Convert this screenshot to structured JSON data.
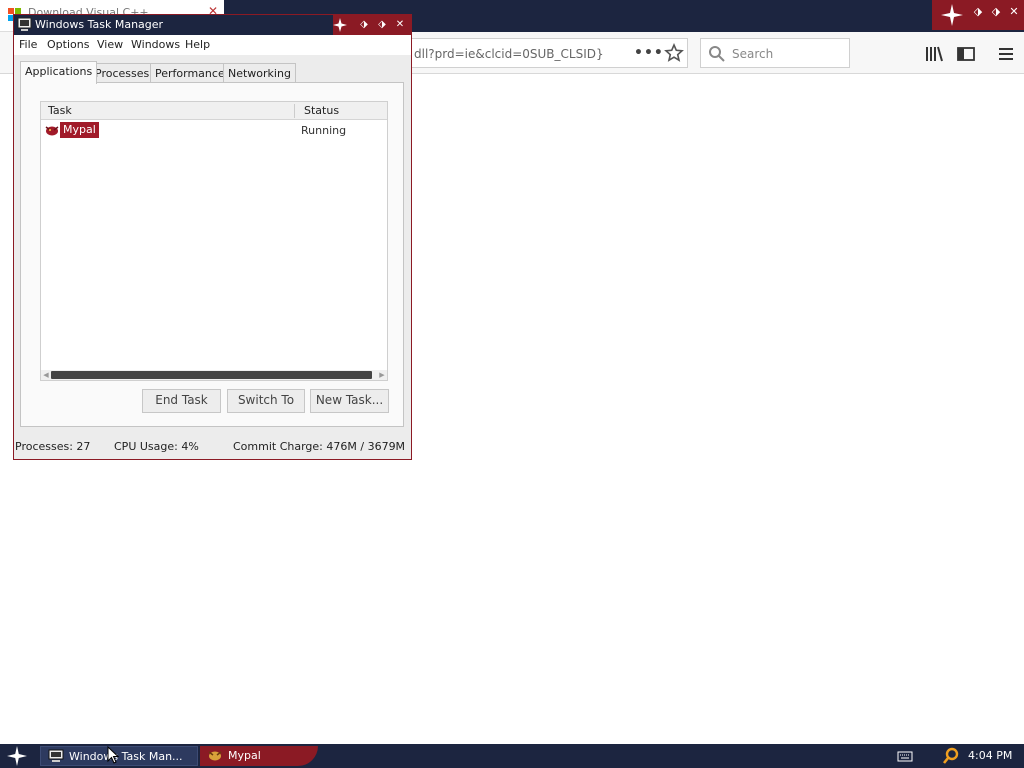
{
  "browser": {
    "tab_title": "Download Visual C++",
    "url_fragment": "dll?prd=ie&clcid=0SUB_CLSID}&",
    "url_overflow_dots": "•••",
    "search_placeholder": "Search",
    "colors": {
      "titlebar": "#1c2540",
      "accent": "#8b1a24"
    }
  },
  "task_manager": {
    "title": "Windows Task Manager",
    "menu": [
      "File",
      "Options",
      "View",
      "Windows",
      "Help"
    ],
    "tabs": [
      "Applications",
      "Processes",
      "Performance",
      "Networking"
    ],
    "active_tab": "Applications",
    "columns": {
      "task": "Task",
      "status": "Status"
    },
    "rows": [
      {
        "task": "Mypal",
        "status": "Running"
      }
    ],
    "buttons": {
      "end_task": "End Task",
      "switch_to": "Switch To",
      "new_task": "New Task..."
    },
    "status_bar": {
      "processes": "Processes: 27",
      "cpu": "CPU Usage: 4%",
      "commit": "Commit Charge: 476M / 3679M"
    }
  },
  "taskbar": {
    "items": [
      {
        "label": "Windows Task Man...",
        "icon": "task-manager-icon"
      },
      {
        "label": "Mypal",
        "icon": "mypal-icon"
      }
    ],
    "clock": "4:04 PM"
  }
}
